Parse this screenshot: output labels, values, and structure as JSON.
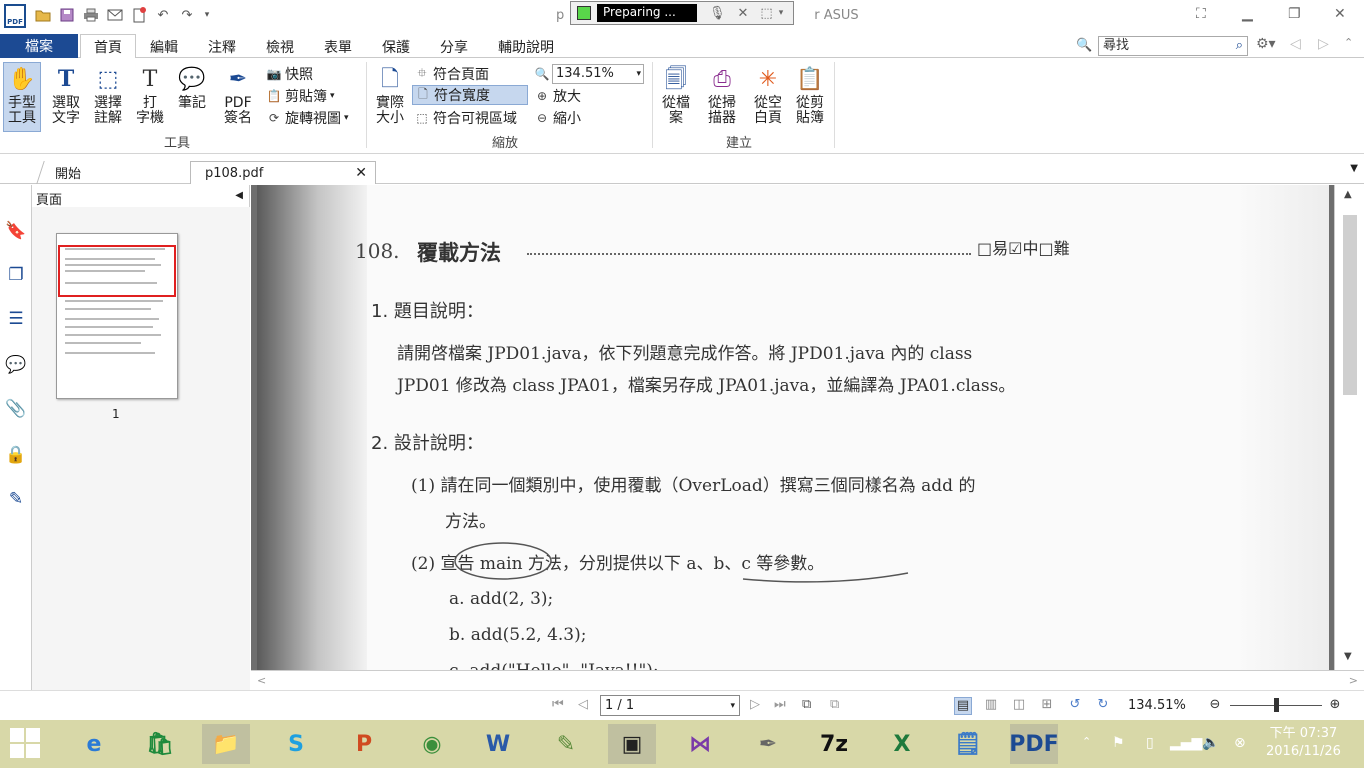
{
  "window": {
    "title_left": "p",
    "title_right": "r ASUS",
    "recorder_status": "Preparing ..."
  },
  "menu": {
    "file": "檔案",
    "tabs": [
      "首頁",
      "編輯",
      "注釋",
      "檢視",
      "表單",
      "保護",
      "分享",
      "輔助說明"
    ],
    "search_placeholder": "尋找"
  },
  "ribbon": {
    "tools": {
      "hand": "手型\n工具",
      "select_text": "選取\n文字",
      "select_annot": "選擇\n註解",
      "typewriter": "打\n字機",
      "note": "筆記",
      "pdf_sign": "PDF\n簽名",
      "snapshot": "快照",
      "clipboard": "剪貼簿",
      "rotate_view": "旋轉視圖",
      "group": "工具"
    },
    "zoom": {
      "actual_size": "實際\n大小",
      "fit_page": "符合頁面",
      "fit_width": "符合寬度",
      "fit_visible": "符合可視區域",
      "zoom_value": "134.51%",
      "zoom_in": "放大",
      "zoom_out": "縮小",
      "group": "縮放"
    },
    "create": {
      "from_file": "從檔\n案",
      "from_scanner": "從掃\n描器",
      "from_blank": "從空\n白頁",
      "from_clipboard": "從剪\n貼簿",
      "group": "建立"
    }
  },
  "doc_tabs": [
    {
      "label": "開始"
    },
    {
      "label": "p108.pdf"
    }
  ],
  "panel": {
    "title": "頁面",
    "thumb_page": "1"
  },
  "page": {
    "heading_num": "108.",
    "heading": "覆載方法",
    "difficulty": "□易☑中□難",
    "s1_title": "1. 題目說明：",
    "s1_line1": "請開啓檔案 JPD01.java，依下列題意完成作答。將 JPD01.java 內的 class",
    "s1_line2": "JPD01 修改為 class JPA01，檔案另存成 JPA01.java，並編譯為 JPA01.class。",
    "s2_title": "2. 設計說明：",
    "item1_line1": "(1) 請在同一個類別中，使用覆載（OverLoad）撰寫三個同樣名為 add 的",
    "item1_line2": "方法。",
    "item2": "(2) 宣告 main 方法，分別提供以下 a、b、c 等參數。",
    "a": "a. add(2, 3);",
    "b": "b. add(5.2, 4.3);",
    "c": "c. add(\"Hello\", \"Java!!\");"
  },
  "status": {
    "page_indicator": "1 / 1",
    "zoom": "134.51%"
  },
  "taskbar": {
    "clock_line1": "下午 07:37",
    "clock_line2": "2016/11/26"
  }
}
